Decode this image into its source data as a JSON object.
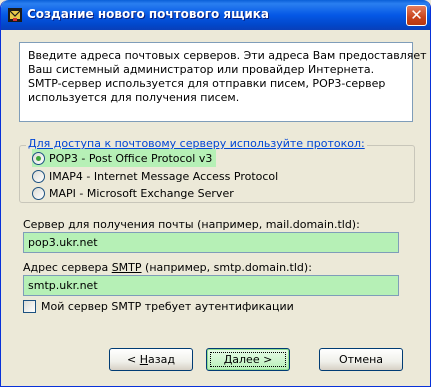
{
  "window": {
    "title": "Создание нового почтового ящика",
    "app_icon": "mail-app-icon",
    "close_icon": "close-icon"
  },
  "info": {
    "lines": [
      "Введите адреса почтовых серверов. Эти адреса Вам предоставляет",
      "Ваш системный администратор или провайдер Интернета.",
      "SMTP-сервер используется для отправки писем, POP3-сервер",
      "используется для получения писем."
    ]
  },
  "protocol_group": {
    "legend": "Для доступа к почтовому серверу используйте протокол:",
    "options": [
      {
        "label": "POP3  -  Post Office Protocol v3",
        "checked": true
      },
      {
        "label": "IMAP4 - Internet Message Access Protocol",
        "checked": false
      },
      {
        "label": "MAPI - Microsoft Exchange Server",
        "checked": false
      }
    ]
  },
  "incoming": {
    "label": "Сервер для получения почты  (например, mail.domain.tld):",
    "value": "pop3.ukr.net"
  },
  "smtp": {
    "label_before": "Адрес сервера ",
    "label_underlined": "SMTP",
    "label_after": " (например, smtp.domain.tld):",
    "value": "smtp.ukr.net"
  },
  "auth": {
    "label": "Мой сервер SMTP требует аутентификации",
    "checked": false
  },
  "buttons": {
    "back_prefix": "< ",
    "back_underlined": "Н",
    "back_rest": "азад",
    "next_underlined": "Д",
    "next_rest": "алее >",
    "cancel": "Отмена"
  },
  "colors": {
    "highlight": "#b6f0b6",
    "titlebar": "#0558e6",
    "legend": "#0046d5"
  }
}
